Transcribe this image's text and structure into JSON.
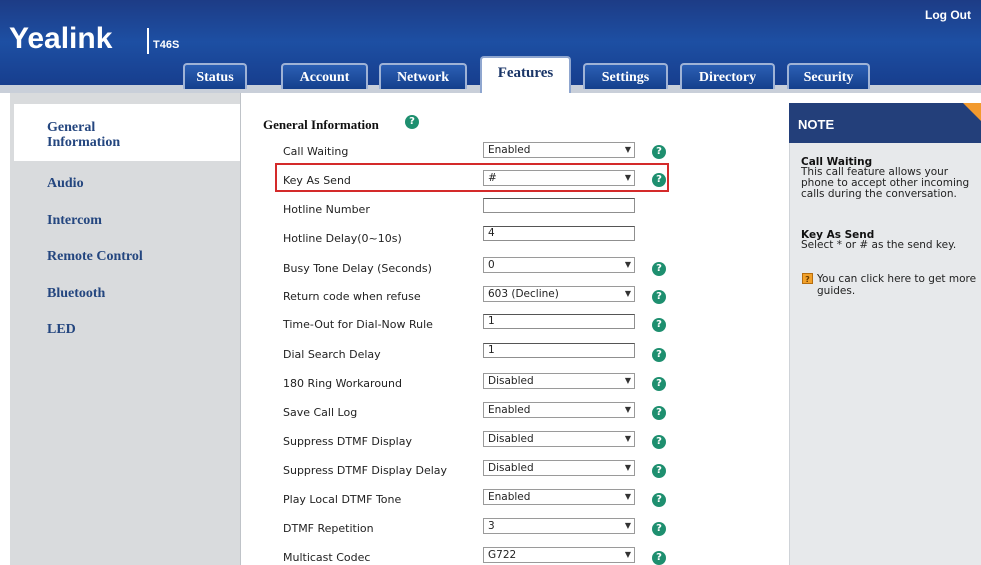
{
  "header": {
    "logo": "Yealink",
    "model": "T46S",
    "logout": "Log Out",
    "tabs": [
      {
        "label": "Status"
      },
      {
        "label": "Account"
      },
      {
        "label": "Network"
      },
      {
        "label": "Features"
      },
      {
        "label": "Settings"
      },
      {
        "label": "Directory"
      },
      {
        "label": "Security"
      }
    ],
    "active_tab": "Features"
  },
  "sidebar": {
    "items": [
      {
        "label": "General Information"
      },
      {
        "label": "Audio"
      },
      {
        "label": "Intercom"
      },
      {
        "label": "Remote Control"
      },
      {
        "label": "Bluetooth"
      },
      {
        "label": "LED"
      }
    ],
    "active": "General Information"
  },
  "main": {
    "section_title": "General Information",
    "rows": [
      {
        "label": "Call Waiting",
        "type": "select",
        "value": "Enabled"
      },
      {
        "label": "Key As Send",
        "type": "select",
        "value": "#",
        "highlighted": true
      },
      {
        "label": "Hotline Number",
        "type": "input",
        "value": ""
      },
      {
        "label": "Hotline Delay(0~10s)",
        "type": "input",
        "value": "4"
      },
      {
        "label": "Busy Tone Delay (Seconds)",
        "type": "select",
        "value": "0"
      },
      {
        "label": "Return code when refuse",
        "type": "select",
        "value": "603 (Decline)"
      },
      {
        "label": "Time-Out for Dial-Now Rule",
        "type": "input",
        "value": "1"
      },
      {
        "label": "Dial Search Delay",
        "type": "input",
        "value": "1"
      },
      {
        "label": "180 Ring Workaround",
        "type": "select",
        "value": "Disabled"
      },
      {
        "label": "Save Call Log",
        "type": "select",
        "value": "Enabled"
      },
      {
        "label": "Suppress DTMF Display",
        "type": "select",
        "value": "Disabled"
      },
      {
        "label": "Suppress DTMF Display Delay",
        "type": "select",
        "value": "Disabled"
      },
      {
        "label": "Play Local DTMF Tone",
        "type": "select",
        "value": "Enabled"
      },
      {
        "label": "DTMF Repetition",
        "type": "select",
        "value": "3"
      },
      {
        "label": "Multicast Codec",
        "type": "select",
        "value": "G722"
      }
    ]
  },
  "note": {
    "title": "NOTE",
    "call_waiting_heading": "Call Waiting",
    "call_waiting_text": "This call feature allows your phone to accept other incoming calls during the conversation.",
    "key_as_send_heading": "Key As Send",
    "key_as_send_text": "Select * or # as the send key.",
    "tip_text": "You can click here to get more guides."
  },
  "icons": {
    "help": "help-icon",
    "dropdown": "chevron-down-icon",
    "tip": "tip-icon"
  },
  "colors": {
    "header_blue": "#1d4fa3",
    "nav_text": "#24467f",
    "help_green": "#1e8f6f",
    "highlight_red": "#d42a2a",
    "note_head": "#233f7a",
    "note_corner": "#f29a2e"
  }
}
